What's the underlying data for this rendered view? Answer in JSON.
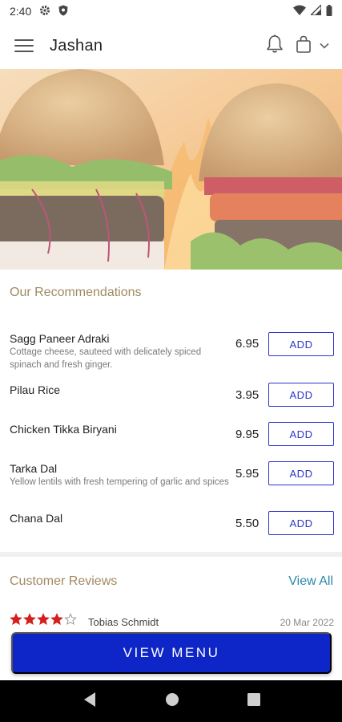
{
  "status_bar": {
    "time": "2:40",
    "icons": [
      "gear-icon",
      "shield-icon",
      "wifi-icon",
      "signal-icon",
      "battery-icon"
    ]
  },
  "app_bar": {
    "title": "Jashan",
    "icons": [
      "menu-icon",
      "bell-icon",
      "shopping-bag-icon",
      "chevron-down-icon"
    ]
  },
  "hero": {
    "image": "burgers-over-flames"
  },
  "recommendations": {
    "title": "Our Recommendations",
    "add_label": "ADD",
    "items": [
      {
        "name": "Sagg Paneer Adraki",
        "description": "Cottage cheese, sauteed with delicately spiced spinach and fresh ginger.",
        "price": "6.95"
      },
      {
        "name": "Pilau Rice",
        "description": "",
        "price": "3.95"
      },
      {
        "name": "Chicken Tikka Biryani",
        "description": "",
        "price": "9.95"
      },
      {
        "name": "Tarka Dal",
        "description": "Yellow lentils with fresh tempering of garlic and spices",
        "price": "5.95"
      },
      {
        "name": "Chana Dal",
        "description": "",
        "price": "5.50"
      }
    ]
  },
  "reviews": {
    "title": "Customer Reviews",
    "view_all": "View All",
    "first": {
      "rating": 4,
      "max_rating": 5,
      "reviewer": "Tobias Schmidt",
      "date": "20 Mar 2022"
    }
  },
  "cta": {
    "label": "VIEW MENU"
  },
  "colors": {
    "accent": "#0e25c8",
    "add_button": "#2c36c8",
    "section_title": "#a08a62",
    "link": "#2a88a8",
    "star": "#d3201e"
  },
  "nav_bar": {
    "icons": [
      "back-icon",
      "home-icon",
      "recents-icon"
    ]
  }
}
